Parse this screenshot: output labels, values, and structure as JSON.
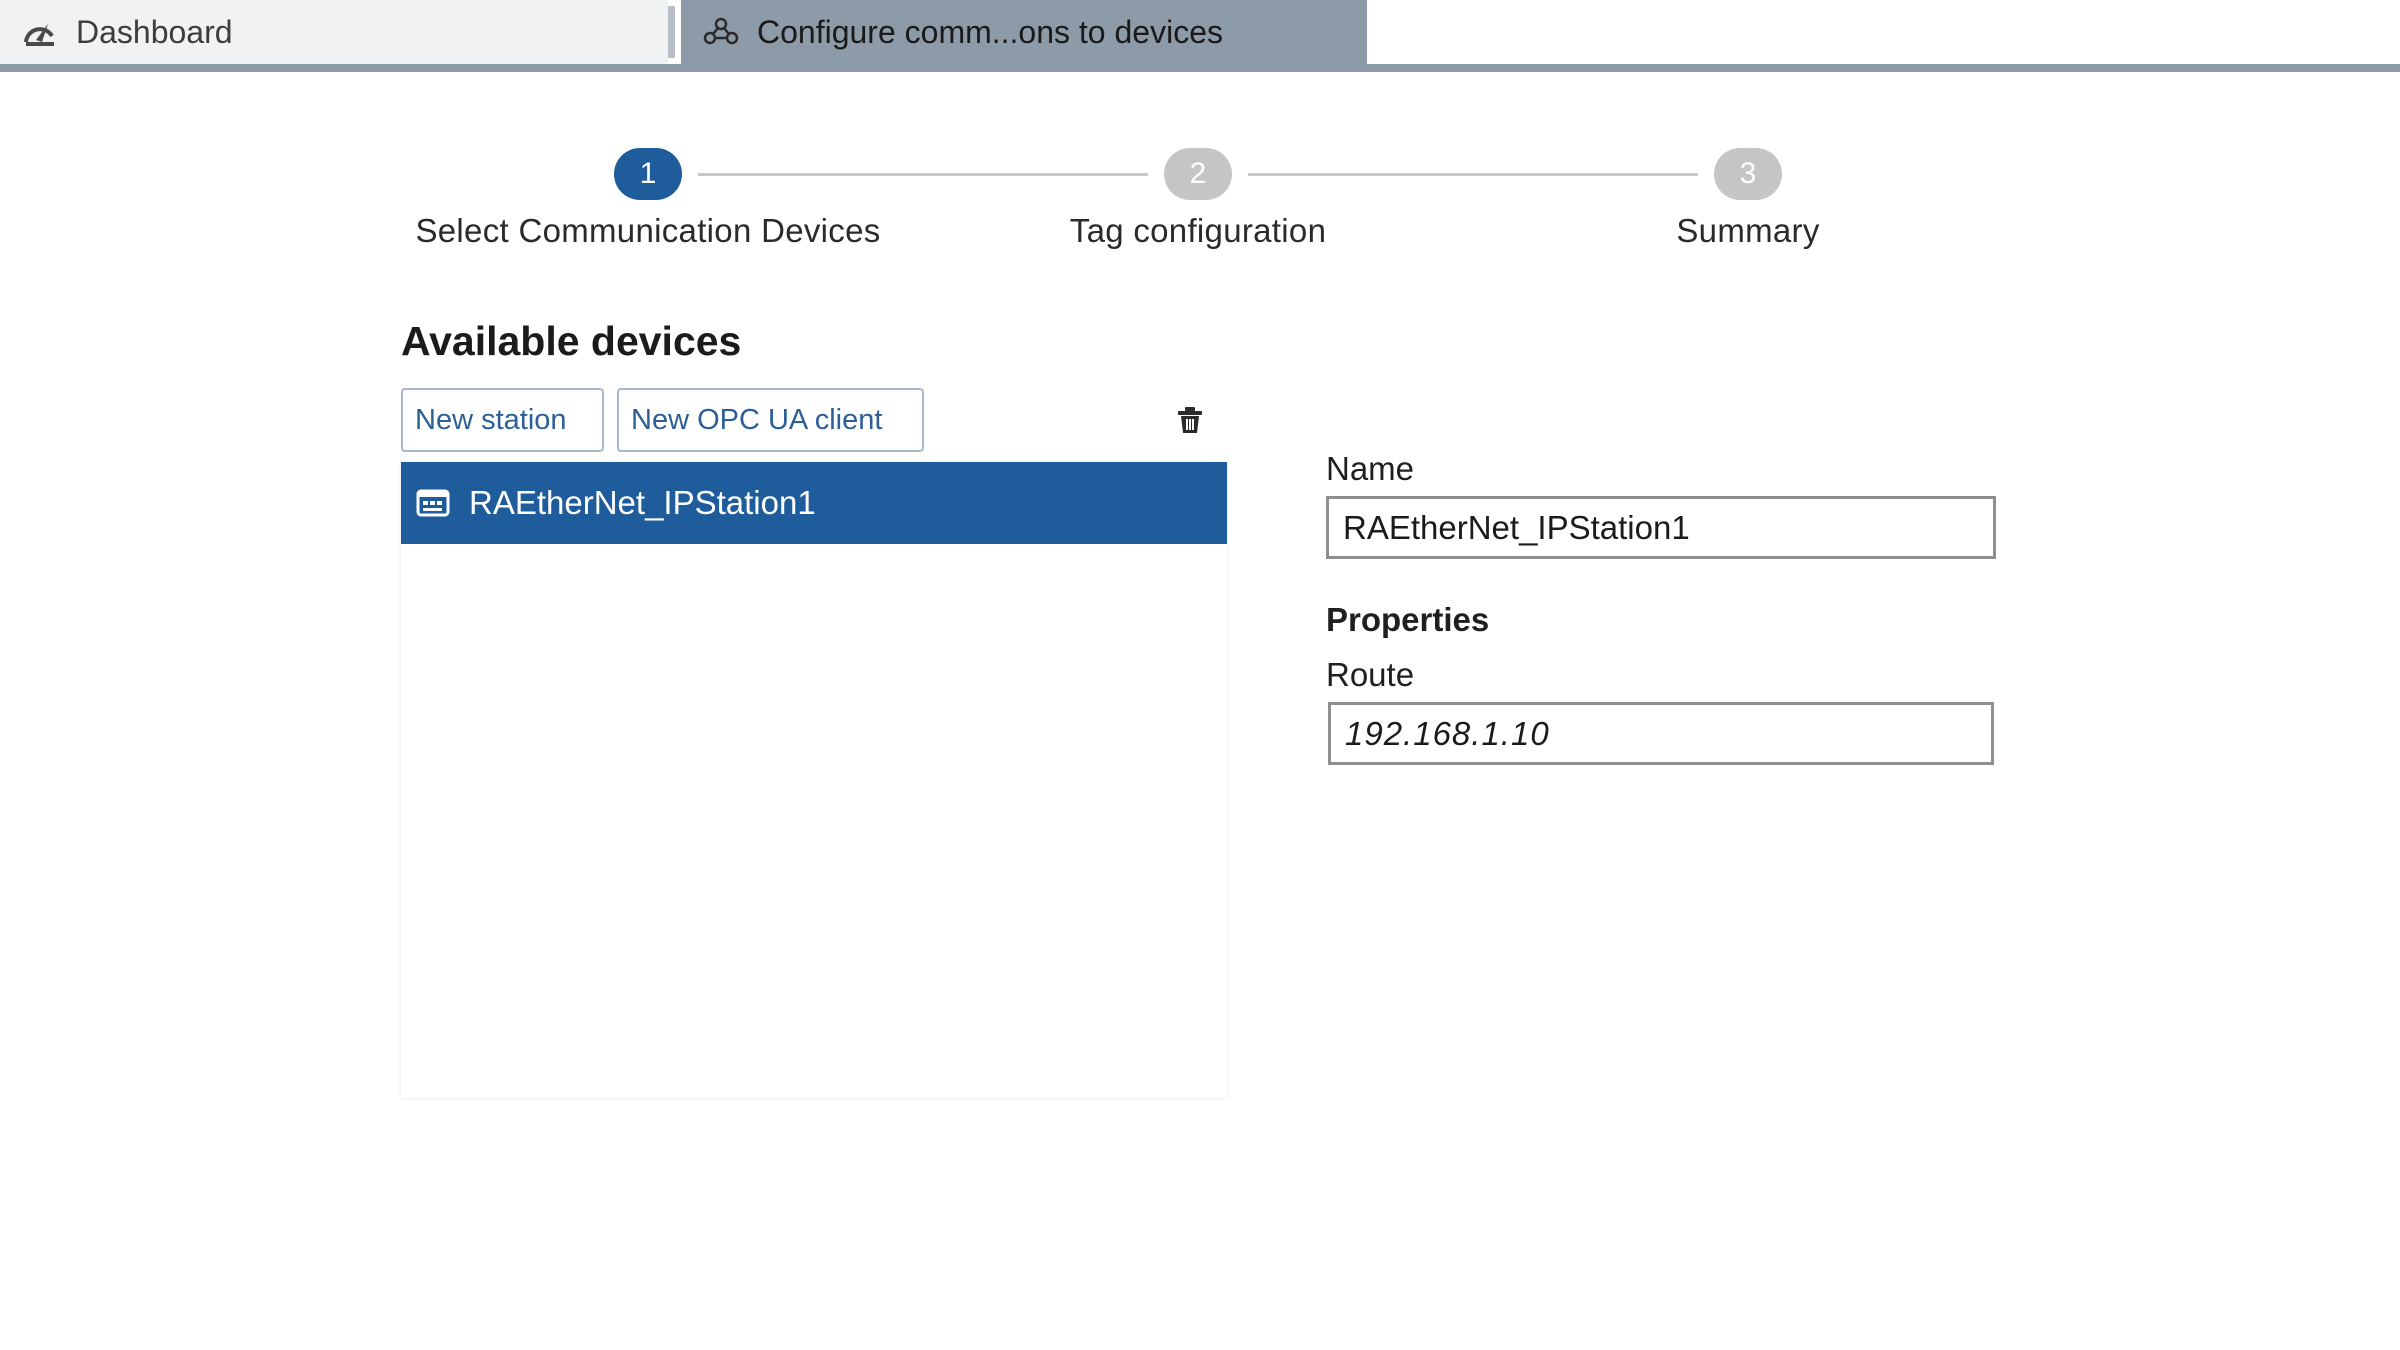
{
  "tabs": [
    {
      "label": "Dashboard",
      "icon": "dashboard-icon"
    },
    {
      "label": "Configure comm...ons to devices",
      "icon": "devices-network-icon"
    }
  ],
  "stepper": {
    "steps": [
      {
        "number": "1",
        "label": "Select Communication Devices",
        "state": "active"
      },
      {
        "number": "2",
        "label": "Tag configuration",
        "state": "inactive"
      },
      {
        "number": "3",
        "label": "Summary",
        "state": "inactive"
      }
    ]
  },
  "devices": {
    "title": "Available devices",
    "new_station_label": "New station",
    "new_opc_label": "New OPC UA client",
    "delete_icon": "trash-icon",
    "items": [
      {
        "name": "RAEtherNet_IPStation1",
        "icon": "station-icon",
        "selected": true
      }
    ]
  },
  "details": {
    "name_label": "Name",
    "name_value": "RAEtherNet_IPStation1",
    "properties_label": "Properties",
    "route_label": "Route",
    "route_value": "192.168.1.10"
  },
  "colors": {
    "accent": "#1f5c9b",
    "active_tab": "#8d9aa7",
    "inactive_step": "#c5c5c5"
  }
}
